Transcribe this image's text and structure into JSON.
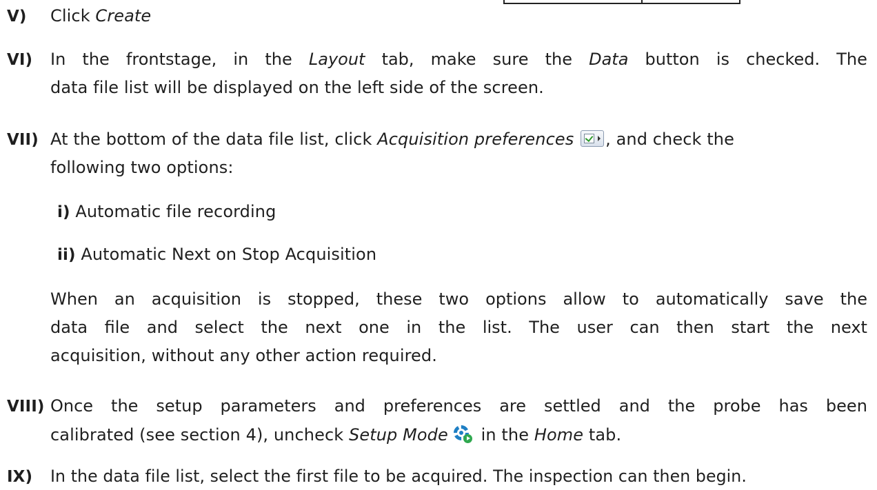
{
  "steps": {
    "v": {
      "num": "V)",
      "t1": "Click ",
      "t2": "Create"
    },
    "vi": {
      "num": "VI)",
      "l1": [
        "In",
        "the",
        "frontstage,",
        "in",
        "the",
        "Layout",
        "tab,",
        "make",
        "sure",
        "the",
        "Data",
        "button",
        "is",
        "checked.",
        "The"
      ],
      "l2": "data file list will be displayed on the left side of the screen."
    },
    "vii": {
      "num": "VII)",
      "a": "At the bottom of the data file list, click ",
      "b": "Acquisition preferences",
      "c": ", and check the",
      "l2": "following two options:"
    },
    "sub_i": {
      "num": "i)",
      "text": " Automatic file recording"
    },
    "sub_ii": {
      "num": "ii)",
      "text": " Automatic Next on Stop Acquisition"
    },
    "para": {
      "l1": [
        "When",
        "an",
        "acquisition",
        "is",
        "stopped,",
        "these",
        "two",
        "options",
        "allow",
        "to",
        "automatically",
        "save",
        "the"
      ],
      "l2": [
        "data",
        "file",
        "and",
        "select",
        "the",
        "next",
        "one",
        "in",
        "the",
        "list.",
        "The",
        "user",
        "can",
        "then",
        "start",
        "the",
        "next"
      ],
      "l3": "acquisition, without any other action required."
    },
    "viii": {
      "num": "VIII)",
      "l1": [
        "Once",
        "the",
        "setup",
        "parameters",
        "and",
        "preferences",
        "are",
        "settled",
        "and",
        "the",
        "probe",
        "has",
        "been"
      ],
      "a": "calibrated (see section 4), uncheck ",
      "b": "Setup Mode",
      "c": " in the ",
      "d": "Home",
      "e": " tab."
    },
    "ix": {
      "num": "IX)",
      "text": "In the data file list, select the first file to be acquired. The inspection can then begin."
    }
  },
  "icons": [
    "acquisition-preferences-icon",
    "setup-mode-icon"
  ]
}
